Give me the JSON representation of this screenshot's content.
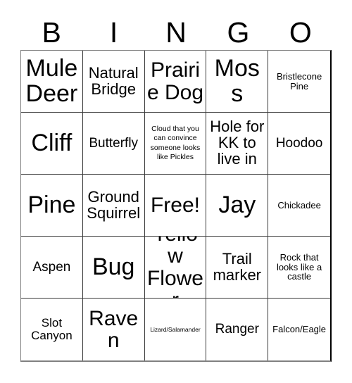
{
  "card": {
    "title_letters": [
      "B",
      "I",
      "N",
      "G",
      "O"
    ],
    "columns": 5,
    "rows": 5,
    "free_space": "Free!",
    "cells": [
      {
        "text": "Mule Deer",
        "size": "fs-xxl"
      },
      {
        "text": "Natural Bridge",
        "size": "fs-l"
      },
      {
        "text": "Prairie Dog",
        "size": "fs-xl"
      },
      {
        "text": "Moss",
        "size": "fs-xxl"
      },
      {
        "text": "Bristlecone Pine",
        "size": "fs-xs"
      },
      {
        "text": "Cliff",
        "size": "fs-xxl"
      },
      {
        "text": "Butterfly",
        "size": "fs-m"
      },
      {
        "text": "Cloud that you can convince someone looks like Pickles",
        "size": "fs-xxs"
      },
      {
        "text": "Hole for KK to live in",
        "size": "fs-l"
      },
      {
        "text": "Hoodoo",
        "size": "fs-m"
      },
      {
        "text": "Pine",
        "size": "fs-xxl"
      },
      {
        "text": "Ground Squirrel",
        "size": "fs-l"
      },
      {
        "text": "Free!",
        "size": "fs-xl"
      },
      {
        "text": "Jay",
        "size": "fs-xxl"
      },
      {
        "text": "Chickadee",
        "size": "fs-xs"
      },
      {
        "text": "Aspen",
        "size": "fs-m"
      },
      {
        "text": "Bug",
        "size": "fs-xxl"
      },
      {
        "text": "Yellow Flower",
        "size": "fs-xl"
      },
      {
        "text": "Trail marker",
        "size": "fs-l"
      },
      {
        "text": "Rock that looks like a castle",
        "size": "fs-xs"
      },
      {
        "text": "Slot Canyon",
        "size": "fs-s"
      },
      {
        "text": "Raven",
        "size": "fs-xl"
      },
      {
        "text": "Lizard/Salamander",
        "size": "fs-tiny"
      },
      {
        "text": "Ranger",
        "size": "fs-m"
      },
      {
        "text": "Falcon/Eagle",
        "size": "fs-xs"
      }
    ]
  },
  "colors": {
    "background": "#ffffff",
    "text": "#000000",
    "grid_line": "#3a3a3a",
    "grid_outer": "#808080"
  }
}
